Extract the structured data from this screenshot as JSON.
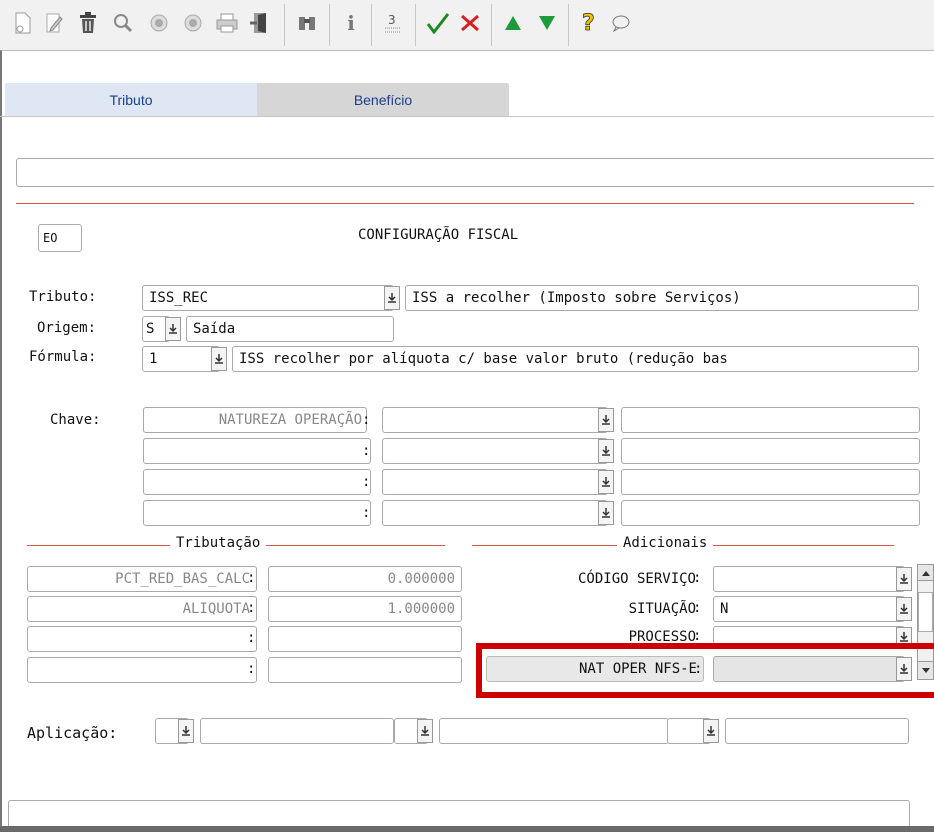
{
  "toolbar": {
    "icons": [
      "new-icon",
      "edit-icon",
      "delete-icon",
      "search-icon",
      "previous-icon",
      "next-icon",
      "print-icon",
      "exit-icon",
      "binoculars-icon",
      "info-icon",
      "sum-icon",
      "confirm-icon",
      "cancel-icon",
      "move-up-icon",
      "move-down-icon",
      "help-icon",
      "chat-icon"
    ],
    "symbols": {
      "delete": "🗑",
      "search": "⚲",
      "previous": "◉",
      "next": "◉",
      "binoculars": "⛶",
      "info": "i",
      "sum": "Σ",
      "confirm": "✓",
      "cancel": "✗",
      "up": "▲",
      "down": "▼",
      "help": "?",
      "chat": "○"
    },
    "colors": {
      "confirm": "#1e8a1e",
      "cancel": "#d42020",
      "arrows": "#1e9a3a",
      "help": "#f0c000"
    }
  },
  "tabs": [
    {
      "label": "Tributo"
    },
    {
      "label": "Benefício"
    }
  ],
  "header": {
    "code": "EO",
    "title": "CONFIGURAÇÃO FISCAL"
  },
  "form": {
    "tributo_label": "Tributo:",
    "tributo_code": "ISS_REC",
    "tributo_desc": "ISS a recolher (Imposto sobre Serviços)",
    "origem_label": "Origem:",
    "origem_code": "S",
    "origem_desc": "Saída",
    "formula_label": "Fórmula:",
    "formula_code": "1",
    "formula_desc": "ISS recolher por alíquota c/ base valor bruto (redução bas",
    "chave_label": "Chave:",
    "chave_rows": [
      "NATUREZA OPERAÇÃO",
      "",
      "",
      ""
    ]
  },
  "tributacao": {
    "title": "Tributação",
    "rows": [
      {
        "name": "PCT_RED_BAS_CALC",
        "value": "0.000000"
      },
      {
        "name": "ALIQUOTA",
        "value": "1.000000"
      },
      {
        "name": "",
        "value": ""
      },
      {
        "name": "",
        "value": ""
      }
    ]
  },
  "adicionais": {
    "title": "Adicionais",
    "rows": [
      {
        "name": "CÓDIGO SERVIÇO",
        "value": ""
      },
      {
        "name": "SITUAÇÃO",
        "value": "N"
      },
      {
        "name": "PROCESSO",
        "value": ""
      },
      {
        "name": "NAT OPER NFS-E",
        "value": ""
      }
    ]
  },
  "aplicacao": {
    "label": "Aplicação:"
  },
  "colon": ":",
  "highlight_color": "#cc0000"
}
